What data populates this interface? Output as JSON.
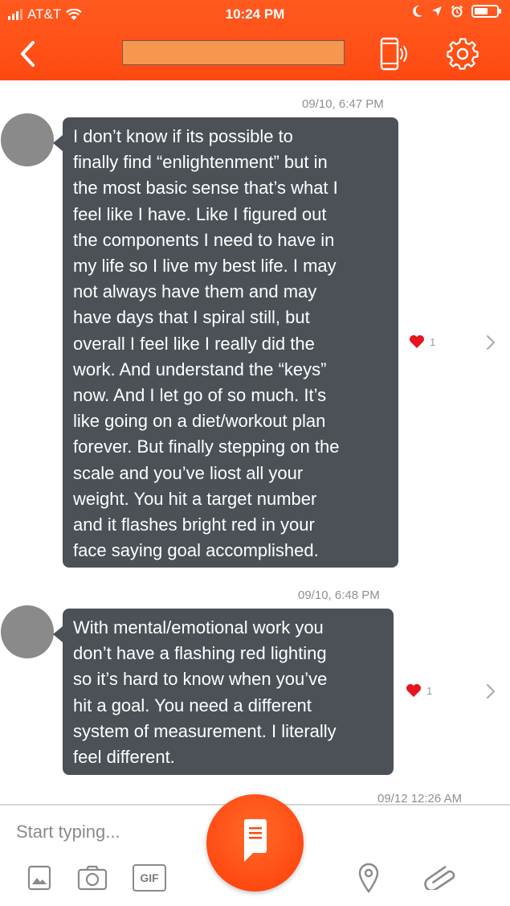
{
  "status_bar": {
    "carrier": "AT&T",
    "time": "10:24 PM",
    "signal_bars": 3,
    "battery_level": 0.6
  },
  "header": {
    "back_icon": "chevron-left-icon",
    "call_icon": "phone-vibrate-icon",
    "settings_icon": "gear-icon"
  },
  "messages": [
    {
      "timestamp": "09/10, 6:47 PM",
      "lines": [
        "I don’t know if its possible to",
        "finally find “enlightenment” but in",
        "the most basic sense that’s what I",
        "feel like I have. Like I figured out",
        "the components I need to have in",
        "my life so I live my best life. I may",
        "not always have them and may",
        "have days that I spiral still, but",
        "overall I feel like I really did the",
        "work. And understand the “keys”",
        "now. And I let go of so much. It’s",
        "like going on a diet/workout plan",
        "forever. But finally stepping on the",
        "scale and you’ve liost all your",
        "weight. You hit a target number",
        "and it flashes bright red in your",
        "face saying goal accomplished."
      ],
      "reaction_count": "1"
    },
    {
      "timestamp": "09/10, 6:48 PM",
      "lines": [
        "With mental/emotional work you",
        "don’t have a flashing red lighting",
        "so it’s hard to know when you’ve",
        "hit a goal. You need a different",
        "system of measurement. I literally",
        "feel different."
      ],
      "reaction_count": "1"
    }
  ],
  "partial_timestamp": "09/12 12:26 AM",
  "composer": {
    "placeholder": "Start typing...",
    "gif_label": "GIF"
  },
  "colors": {
    "brand": "#ff4a12",
    "bubble": "#4c5158",
    "heart": "#e8141e"
  }
}
